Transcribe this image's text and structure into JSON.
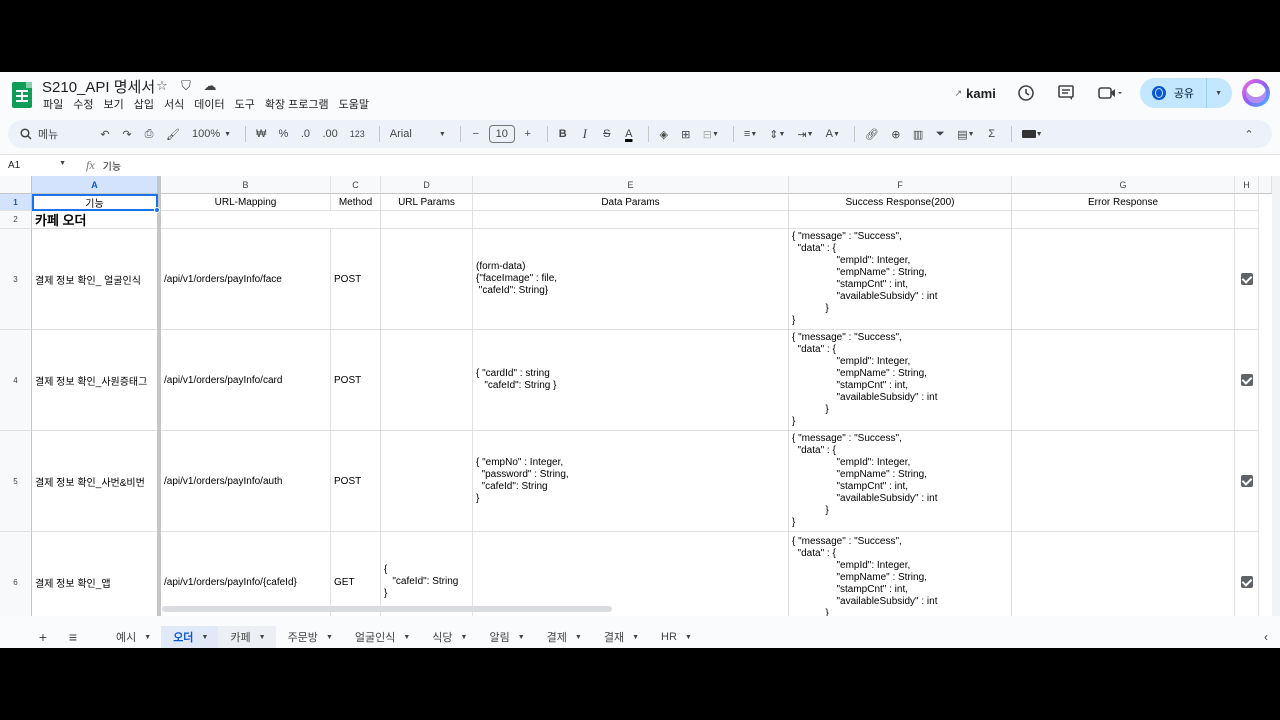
{
  "app": {
    "doc_title": "S210_API 명세서",
    "menu": [
      "파일",
      "수정",
      "보기",
      "삽입",
      "서식",
      "데이터",
      "도구",
      "확장 프로그램",
      "도움말"
    ],
    "kami_label": "kami",
    "share_label": "공유"
  },
  "toolbar": {
    "search_label": "메뉴",
    "zoom": "100%",
    "currency": "₩",
    "percent": "%",
    "dec_decrease": ".0",
    "dec_increase": ".00",
    "number_format": "123",
    "font": "Arial",
    "font_size": "10",
    "bold": "B",
    "italic": "I",
    "strike": "S",
    "text_color": "A",
    "sum": "Σ"
  },
  "formula_bar": {
    "cell_ref": "A1",
    "fx": "fx",
    "value": "기능"
  },
  "columns": [
    "A",
    "B",
    "C",
    "D",
    "E",
    "F",
    "G",
    "H"
  ],
  "rows": [
    "1",
    "2",
    "3",
    "4",
    "5",
    "6"
  ],
  "header_row": {
    "a": "기능",
    "b": "URL-Mapping",
    "c": "Method",
    "d": "URL Params",
    "e": "Data Params",
    "f": "Success Response(200)",
    "g": "Error Response"
  },
  "section_title": "카페 오더",
  "data_rows": [
    {
      "a": "결제 정보 확인_ 얼굴인식",
      "b": "/api/v1/orders/payInfo/face",
      "c": "POST",
      "d": "",
      "e": "(form-data)\n{\"faceImage\" : file,\n \"cafeId\": String}",
      "f": "{ \"message\" : \"Success\",\n  \"data\" : {\n                \"empId\": Integer,\n                \"empName\" : String,\n                \"stampCnt\" : int,\n                \"availableSubsidy\" : int\n            }\n}"
    },
    {
      "a": "결제 정보 확인_사원증태그",
      "b": "/api/v1/orders/payInfo/card",
      "c": "POST",
      "d": "",
      "e": "{ \"cardId\" : string\n   \"cafeId\": String }",
      "f": "{ \"message\" : \"Success\",\n  \"data\" : {\n                \"empId\": Integer,\n                \"empName\" : String,\n                \"stampCnt\" : int,\n                \"availableSubsidy\" : int\n            }\n}"
    },
    {
      "a": "결제 정보 확인_사번&비번",
      "b": "/api/v1/orders/payInfo/auth",
      "c": "POST",
      "d": "",
      "e": "{ \"empNo\" : Integer,\n  \"password\" : String,\n  \"cafeId\": String\n}",
      "f": "{ \"message\" : \"Success\",\n  \"data\" : {\n                \"empId\": Integer,\n                \"empName\" : String,\n                \"stampCnt\" : int,\n                \"availableSubsidy\" : int\n            }\n}"
    },
    {
      "a": "결제 정보 확인_앱",
      "b": "/api/v1/orders/payInfo/{cafeId}",
      "c": "GET",
      "d": "{\n   \"cafeId\": String\n}",
      "e": "",
      "f": "{ \"message\" : \"Success\",\n  \"data\" : {\n                \"empId\": Integer,\n                \"empName\" : String,\n                \"stampCnt\" : int,\n                \"availableSubsidy\" : int\n            }"
    }
  ],
  "sheet_tabs": [
    "예시",
    "오더",
    "카페",
    "주문방",
    "얼굴인식",
    "식당",
    "알림",
    "결제",
    "결재",
    "HR"
  ],
  "active_tab": "오더",
  "colors": {
    "accent": "#1a73e8",
    "share_bg": "#c2e7ff",
    "sheets_green": "#0f9d58"
  }
}
